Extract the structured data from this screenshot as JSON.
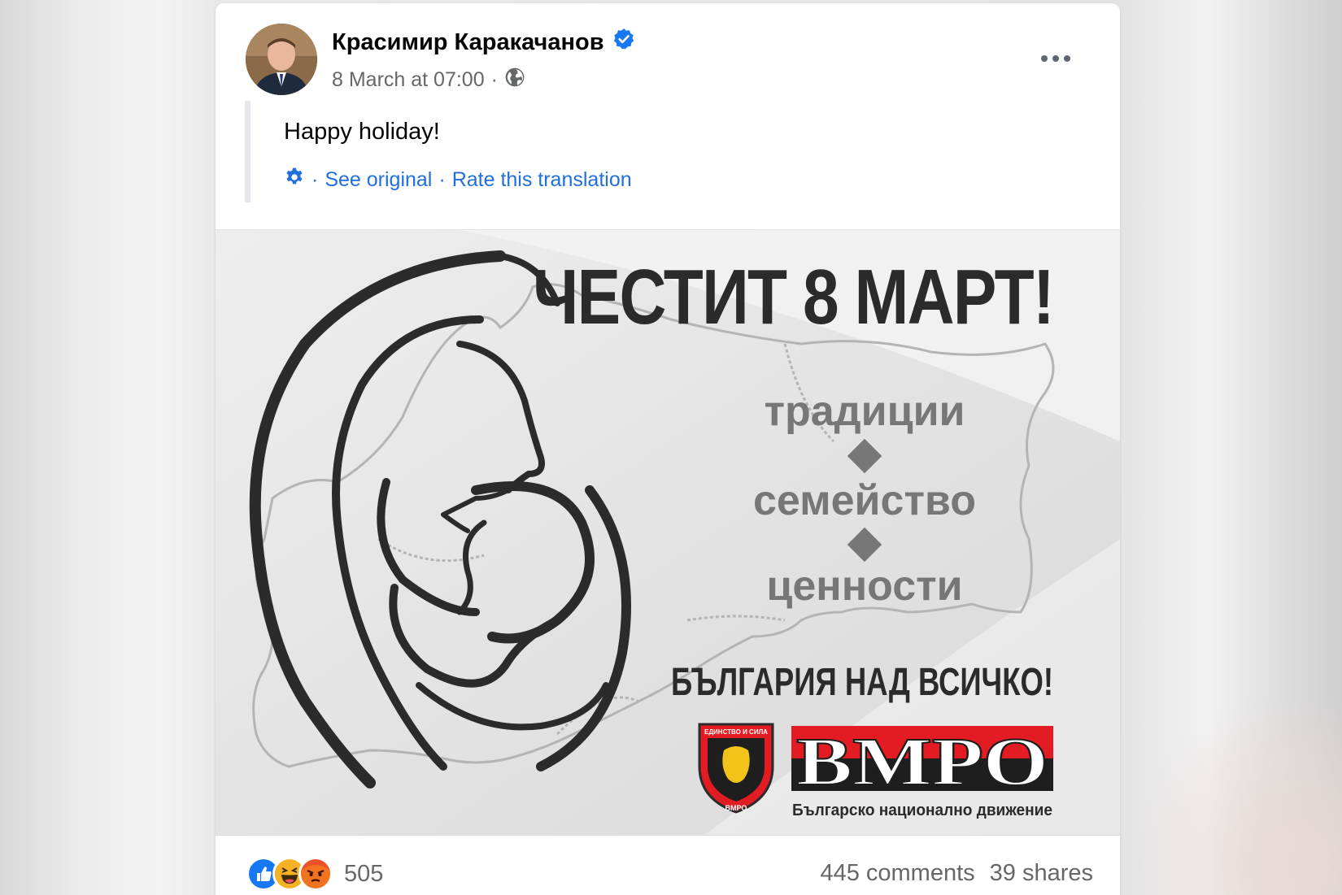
{
  "post": {
    "author": "Красимир Каракачанов",
    "date": "8 March at 07:00",
    "separator": "·",
    "text": "Happy holiday!",
    "translation": {
      "see_original": "See original",
      "rate": "Rate this translation",
      "dot": "·"
    }
  },
  "image": {
    "headline": "ЧЕСТИТ 8 МАРТ!",
    "word1": "традиции",
    "word2": "семейство",
    "word3": "ценности",
    "slogan": "БЪЛГАРИЯ НАД ВСИЧКО!",
    "logo_text": "ВМРО",
    "logo_subtitle": "Българско национално движение",
    "emblem_top": "ЕДИНСТВО И СИЛА",
    "emblem_bottom": "ВМРО"
  },
  "footer": {
    "reaction_count": "505",
    "comments": "445 comments",
    "shares": "39 shares"
  },
  "icons": {
    "verified": "verified-badge-icon",
    "globe": "globe-icon",
    "more": "more-options-icon",
    "gear": "gear-icon",
    "like": "like-reaction-icon",
    "haha": "haha-reaction-icon",
    "angry": "angry-reaction-icon"
  },
  "colors": {
    "link": "#216fdb",
    "verified": "#1877f2",
    "logo_red": "#e31b23"
  }
}
